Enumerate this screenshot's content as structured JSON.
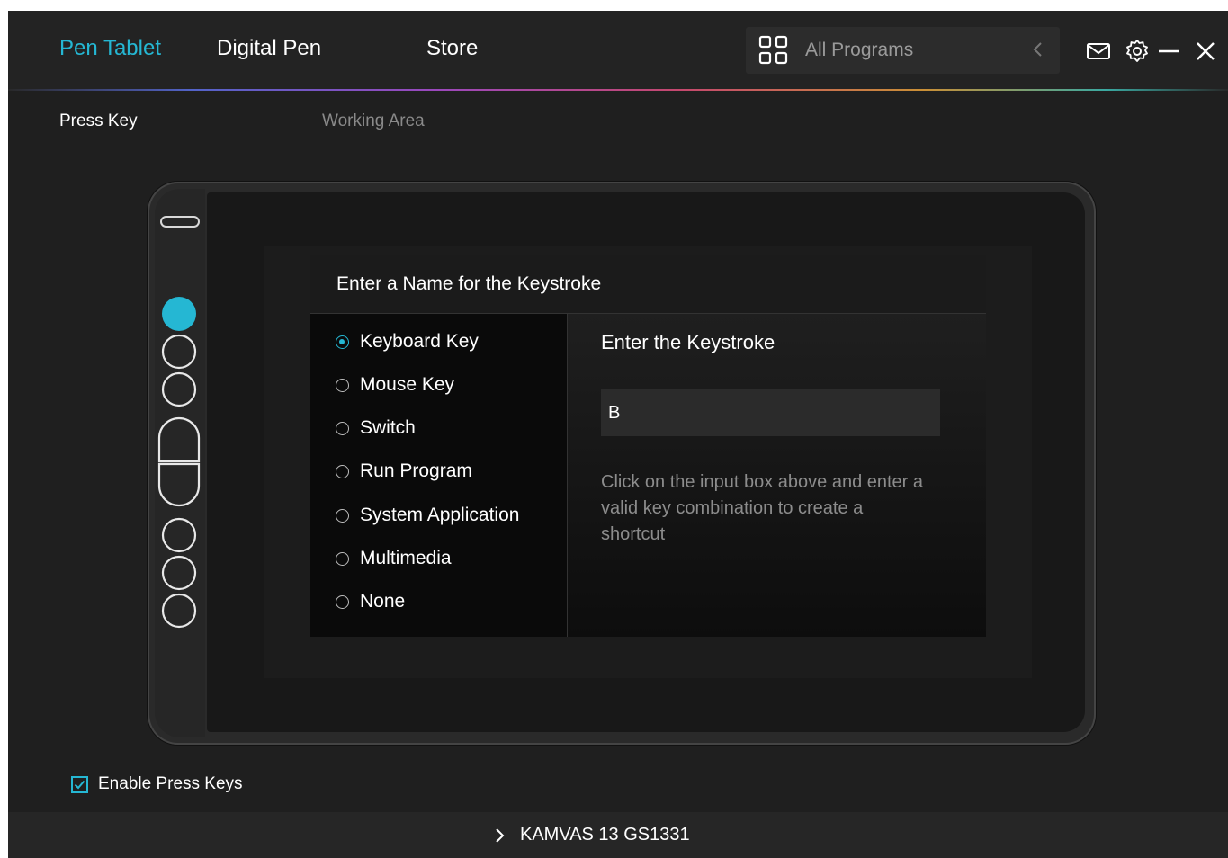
{
  "header": {
    "tabs": [
      {
        "label": "Pen Tablet",
        "active": true
      },
      {
        "label": "Digital Pen",
        "active": false
      },
      {
        "label": "Store",
        "active": false
      }
    ],
    "program_selector": {
      "label": "All Programs",
      "icon": "grid-icon"
    },
    "icons": [
      "mail-icon",
      "gear-icon",
      "minimize-icon",
      "close-icon"
    ]
  },
  "subtabs": [
    {
      "label": "Press Key",
      "active": true
    },
    {
      "label": "Working Area",
      "active": false
    }
  ],
  "dialog": {
    "title": "Enter a Name for the Keystroke",
    "options": [
      {
        "label": "Keyboard Key",
        "selected": true
      },
      {
        "label": "Mouse Key",
        "selected": false
      },
      {
        "label": "Switch",
        "selected": false
      },
      {
        "label": "Run Program",
        "selected": false
      },
      {
        "label": "System Application",
        "selected": false
      },
      {
        "label": "Multimedia",
        "selected": false
      },
      {
        "label": "None",
        "selected": false
      }
    ],
    "keystroke_title": "Enter the Keystroke",
    "keystroke_value": "B",
    "hint": "Click on the input box above and enter a valid key combination to create a shortcut"
  },
  "enable_press_keys": {
    "label": "Enable Press Keys",
    "checked": true
  },
  "footer": {
    "device_name": "KAMVAS 13 GS1331"
  },
  "colors": {
    "accent": "#25b7d3",
    "background": "#1f1f1f"
  }
}
